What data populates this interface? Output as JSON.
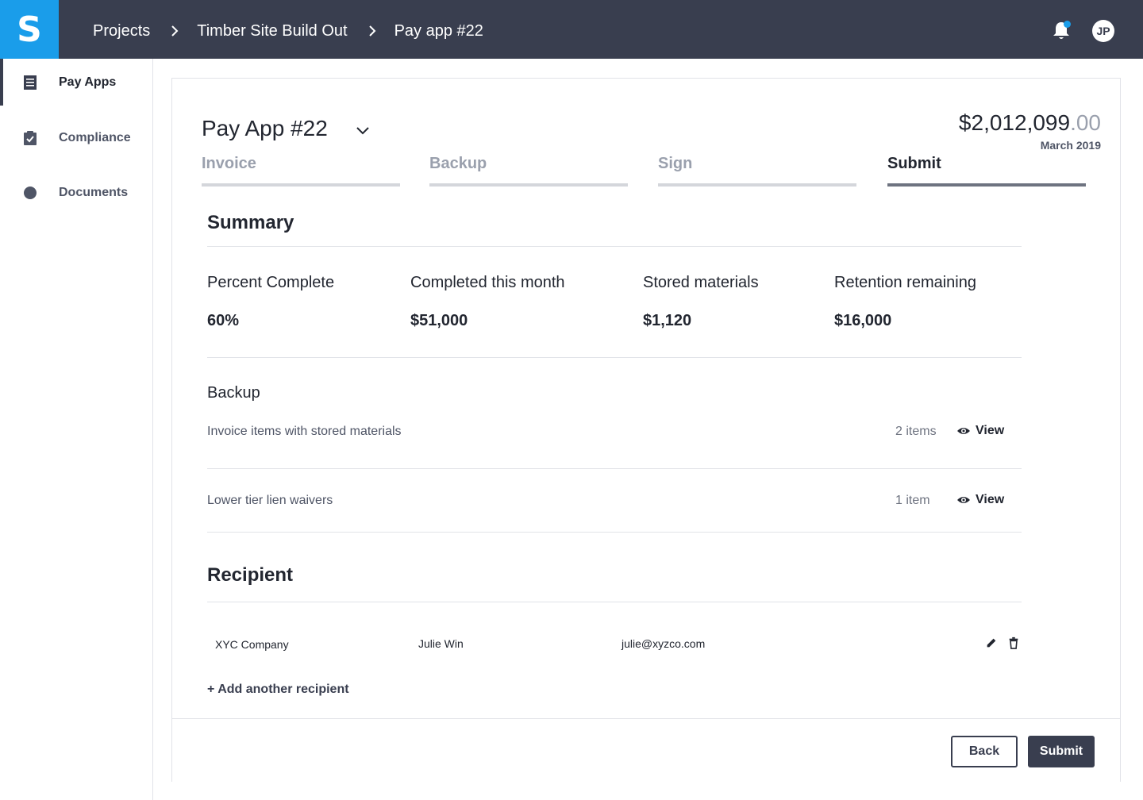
{
  "app": {
    "logo_letter": "S"
  },
  "breadcrumb": [
    "Projects",
    "Timber Site Build Out",
    "Pay app #22"
  ],
  "user": {
    "initials": "JP"
  },
  "sidebar": {
    "items": [
      {
        "label": "Pay Apps",
        "icon": "document-list-icon",
        "active": true
      },
      {
        "label": "Compliance",
        "icon": "clipboard-check-icon",
        "active": false
      },
      {
        "label": "Documents",
        "icon": "circle-icon",
        "active": false
      }
    ]
  },
  "header": {
    "title": "Pay App #22",
    "amount_whole": "$2,012,099",
    "amount_cents": ".00",
    "date": "March 2019"
  },
  "tabs": [
    "Invoice",
    "Backup",
    "Sign",
    "Submit"
  ],
  "active_tab": "Submit",
  "summary": {
    "title": "Summary",
    "stats": [
      {
        "label": "Percent Complete",
        "value": "60%"
      },
      {
        "label": "Completed this month",
        "value": "$51,000"
      },
      {
        "label": "Stored materials",
        "value": "$1,120"
      },
      {
        "label": "Retention remaining",
        "value": "$16,000"
      }
    ]
  },
  "backup": {
    "title": "Backup",
    "rows": [
      {
        "label": "Invoice items with stored materials",
        "count": "2 items",
        "action": "View"
      },
      {
        "label": "Lower tier lien waivers",
        "count": "1 item",
        "action": "View"
      }
    ]
  },
  "recipient": {
    "title": "Recipient",
    "company": "XYC Company",
    "name": "Julie Win",
    "email": "julie@xyzco.com",
    "add_label": "+ Add another recipient"
  },
  "footer": {
    "back_label": "Back",
    "submit_label": "Submit"
  },
  "colors": {
    "topbar": "#393e4f",
    "brand": "#1a9dea",
    "text": "#222630",
    "muted": "#9aa0ad"
  }
}
